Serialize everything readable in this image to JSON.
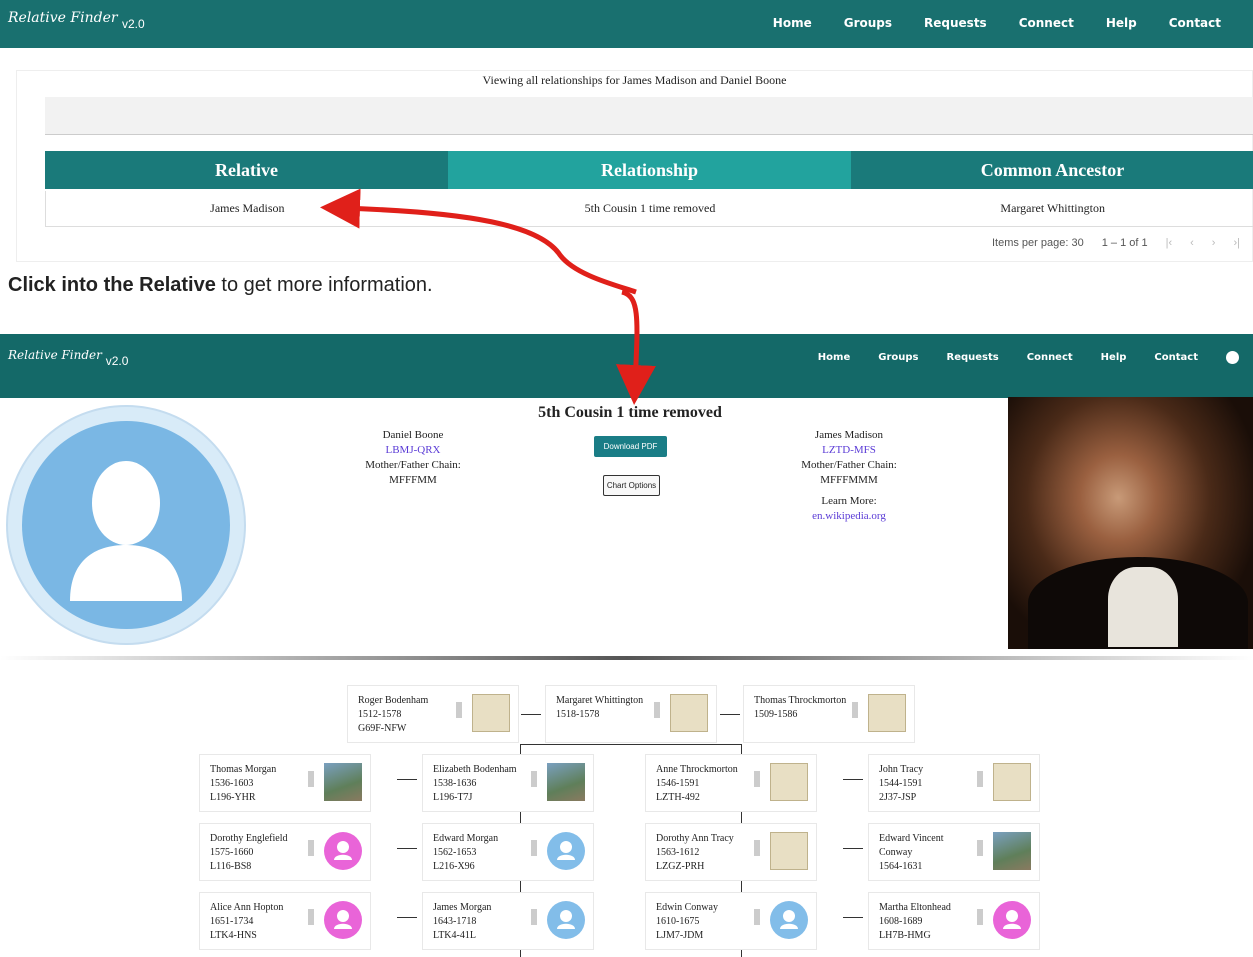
{
  "nav": {
    "logo_main": "Relative Finder",
    "version": "v2.0",
    "links": [
      "Home",
      "Groups",
      "Requests",
      "Connect",
      "Help",
      "Contact"
    ]
  },
  "list": {
    "viewing": "Viewing all relationships for James Madison and Daniel Boone",
    "headers": [
      "Relative",
      "Relationship",
      "Common Ancestor"
    ],
    "row": [
      "James Madison",
      "5th Cousin 1 time removed",
      "Margaret Whittington"
    ],
    "pager": {
      "label": "Items per page: 30",
      "range": "1 – 1 of 1"
    }
  },
  "note": {
    "bold": "Click into the Relative",
    "rest": " to get more information."
  },
  "detail": {
    "title": "5th Cousin 1 time removed",
    "left": {
      "name": "Daniel Boone",
      "id": "LBMJ-QRX",
      "chain_label": "Mother/Father Chain:",
      "chain": "MFFFMM"
    },
    "right": {
      "name": "James Madison",
      "id": "LZTD-MFS",
      "chain_label": "Mother/Father Chain:",
      "chain": "MFFFMMM",
      "learn": "Learn More:",
      "link": "en.wikipedia.org"
    },
    "pdf": "Download PDF",
    "chart_options": "Chart Options"
  },
  "tree": {
    "top": [
      {
        "name": "Roger Bodenham",
        "years": "1512-1578",
        "id": "G69F-NFW",
        "thumb": "doc"
      },
      {
        "name": "Margaret Whittington",
        "years": "1518-1578",
        "id": "",
        "thumb": "doc"
      },
      {
        "name": "Thomas Throckmorton",
        "years": "1509-1586",
        "id": "",
        "thumb": "doc"
      }
    ],
    "rows": [
      [
        {
          "name": "Thomas Morgan",
          "years": "1536-1603",
          "id": "L196-YHR",
          "thumb": "photo"
        },
        {
          "name": "Elizabeth Bodenham",
          "years": "1538-1636",
          "id": "L196-T7J",
          "thumb": "photo"
        },
        {
          "name": "Anne Throckmorton",
          "years": "1546-1591",
          "id": "LZTH-492",
          "thumb": "doc"
        },
        {
          "name": "John Tracy",
          "years": "1544-1591",
          "id": "2J37-JSP",
          "thumb": "doc"
        }
      ],
      [
        {
          "name": "Dorothy Englefield",
          "years": "1575-1660",
          "id": "L116-BS8",
          "thumb": "f"
        },
        {
          "name": "Edward Morgan",
          "years": "1562-1653",
          "id": "L216-X96",
          "thumb": "m"
        },
        {
          "name": "Dorothy Ann Tracy",
          "years": "1563-1612",
          "id": "LZGZ-PRH",
          "thumb": "doc"
        },
        {
          "name": "Edward Vincent Conway",
          "years": "1564-1631",
          "id": "",
          "thumb": "photo"
        }
      ],
      [
        {
          "name": "Alice Ann Hopton",
          "years": "1651-1734",
          "id": "LTK4-HNS",
          "thumb": "f"
        },
        {
          "name": "James Morgan",
          "years": "1643-1718",
          "id": "LTK4-41L",
          "thumb": "m"
        },
        {
          "name": "Edwin Conway",
          "years": "1610-1675",
          "id": "LJM7-JDM",
          "thumb": "m"
        },
        {
          "name": "Martha Eltonhead",
          "years": "1608-1689",
          "id": "LH7B-HMG",
          "thumb": "f"
        }
      ]
    ]
  }
}
